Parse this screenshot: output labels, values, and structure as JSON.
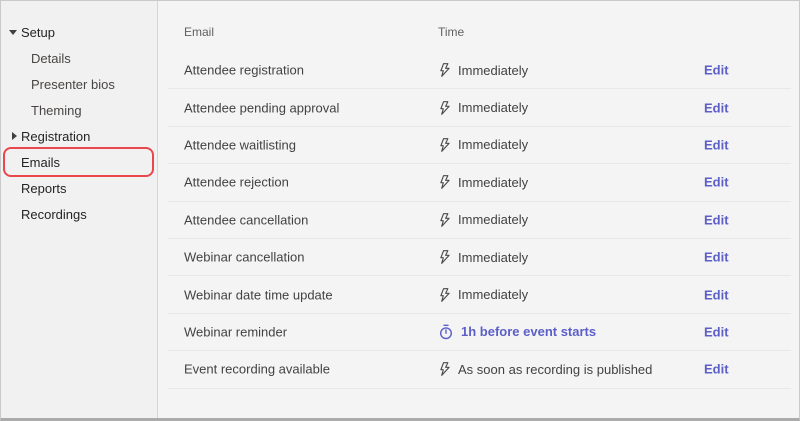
{
  "colors": {
    "accent": "#5b5fc7",
    "selection_highlight": "#e8474d",
    "body_text": "#424242",
    "header_text": "#616161",
    "sidebar_bg": "#f2f1f1",
    "content_bg": "#f5f4f4"
  },
  "sidebar": {
    "items": [
      {
        "label": "Setup",
        "caret": "down",
        "indent": false,
        "selected": false
      },
      {
        "label": "Details",
        "caret": "none",
        "indent": true,
        "selected": false
      },
      {
        "label": "Presenter bios",
        "caret": "none",
        "indent": true,
        "selected": false
      },
      {
        "label": "Theming",
        "caret": "none",
        "indent": true,
        "selected": false
      },
      {
        "label": "Registration",
        "caret": "right",
        "indent": false,
        "selected": false
      },
      {
        "label": "Emails",
        "caret": "none",
        "indent": false,
        "selected": true
      },
      {
        "label": "Reports",
        "caret": "none",
        "indent": false,
        "selected": false
      },
      {
        "label": "Recordings",
        "caret": "none",
        "indent": false,
        "selected": false
      }
    ]
  },
  "table": {
    "columns": {
      "email": "Email",
      "time": "Time"
    },
    "edit_label": "Edit",
    "rows": [
      {
        "email": "Attendee registration",
        "time": "Immediately",
        "icon": "lightning-icon",
        "accent": false
      },
      {
        "email": "Attendee pending approval",
        "time": "Immediately",
        "icon": "lightning-icon",
        "accent": false
      },
      {
        "email": "Attendee waitlisting",
        "time": "Immediately",
        "icon": "lightning-icon",
        "accent": false
      },
      {
        "email": "Attendee rejection",
        "time": "Immediately",
        "icon": "lightning-icon",
        "accent": false
      },
      {
        "email": "Attendee cancellation",
        "time": "Immediately",
        "icon": "lightning-icon",
        "accent": false
      },
      {
        "email": "Webinar cancellation",
        "time": "Immediately",
        "icon": "lightning-icon",
        "accent": false
      },
      {
        "email": "Webinar date time update",
        "time": "Immediately",
        "icon": "lightning-icon",
        "accent": false
      },
      {
        "email": "Webinar reminder",
        "time": "1h before event starts",
        "icon": "timer-icon",
        "accent": true
      },
      {
        "email": "Event recording available",
        "time": "As soon as recording is published",
        "icon": "lightning-icon",
        "accent": false
      }
    ]
  }
}
